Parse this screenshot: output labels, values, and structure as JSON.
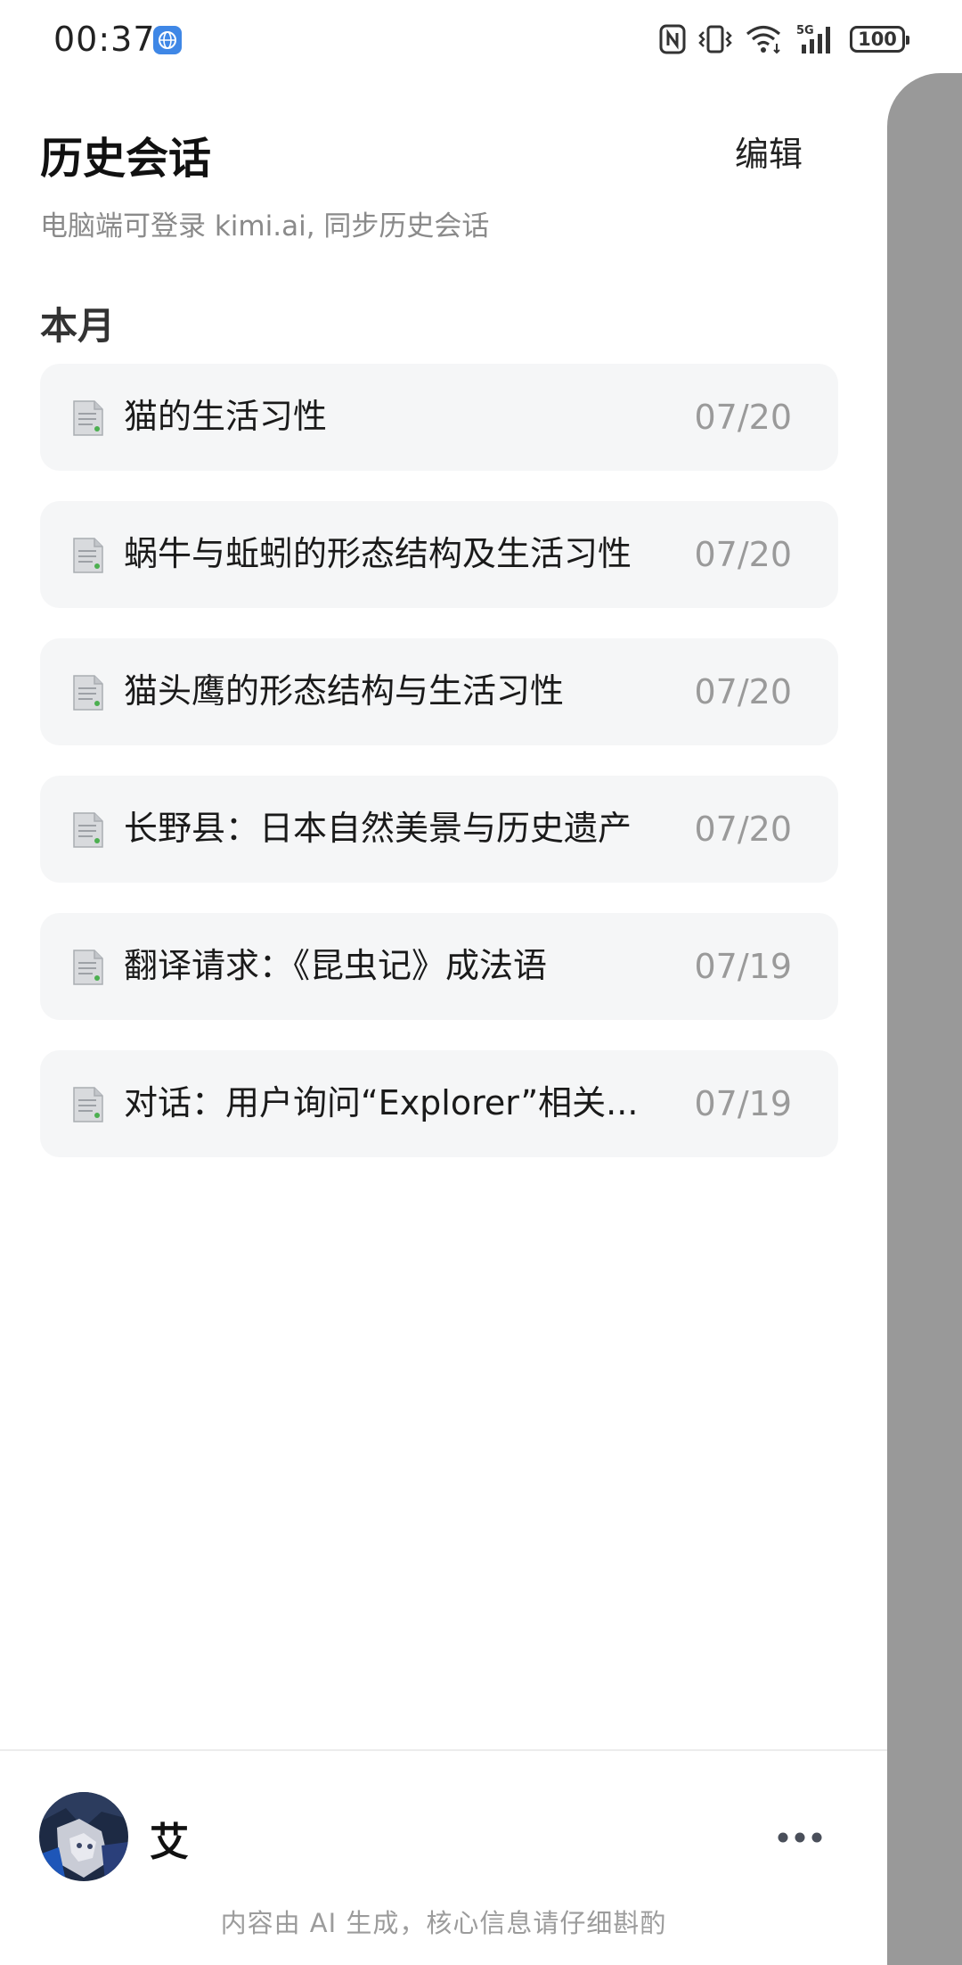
{
  "status_bar": {
    "time": "00:37",
    "battery": "100",
    "icons": [
      "globe-icon",
      "nfc-icon",
      "vibrate-icon",
      "wifi-icon",
      "signal-5g-icon",
      "battery-icon"
    ]
  },
  "drawer": {
    "title": "历史会话",
    "edit_label": "编辑",
    "subtitle": "电脑端可登录 kimi.ai, 同步历史会话",
    "section_label": "本月",
    "items": [
      {
        "title": "猫的生活习性",
        "date": "07/20",
        "icon": "document-icon"
      },
      {
        "title": "蜗牛与蚯蚓的形态结构及生活习性",
        "date": "07/20",
        "icon": "document-icon"
      },
      {
        "title": "猫头鹰的形态结构与生活习性",
        "date": "07/20",
        "icon": "document-icon"
      },
      {
        "title": "长野县：日本自然美景与历史遗产",
        "date": "07/20",
        "icon": "document-icon"
      },
      {
        "title": "翻译请求：《昆虫记》成法语",
        "date": "07/19",
        "icon": "document-icon"
      },
      {
        "title": "对话：用户询问“Explorer”相关...",
        "date": "07/19",
        "icon": "document-icon"
      }
    ]
  },
  "footer": {
    "user_name": "艾",
    "more_icon": "more-icon",
    "note": "内容由 AI 生成，核心信息请仔细斟酌"
  },
  "colors": {
    "item_background": "#f5f6f7",
    "side_panel": "#999999",
    "muted_text": "#9a9a9a"
  }
}
